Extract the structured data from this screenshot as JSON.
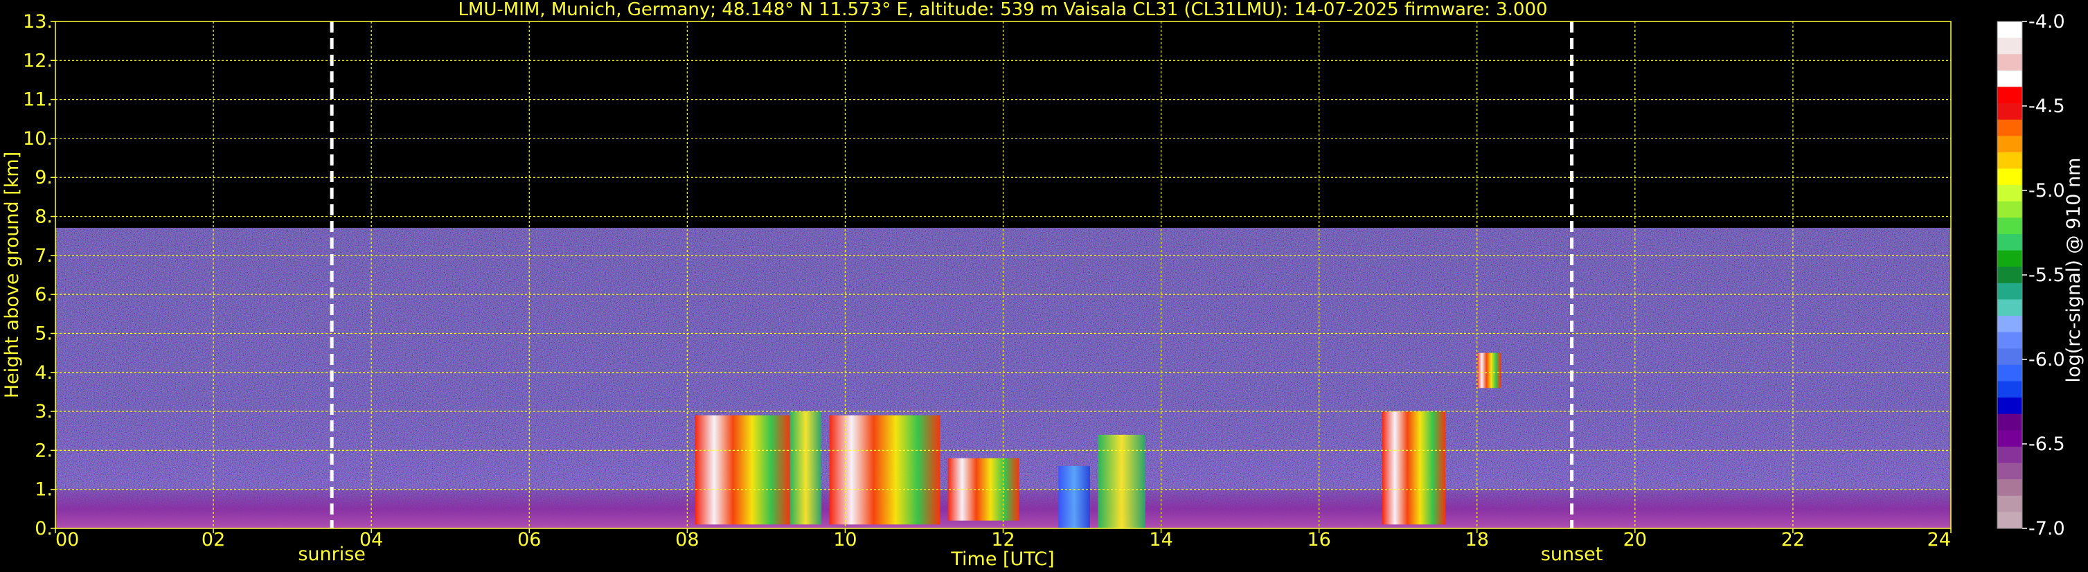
{
  "chart_data": {
    "type": "heatmap",
    "title": "LMU-MIM, Munich, Germany; 48.148° N 11.573° E, altitude: 539 m    Vaisala CL31 (CL31LMU): 14-07-2025    firmware: 3.000",
    "xlabel": "Time [UTC]",
    "ylabel": "Height above ground [km]",
    "xlim": [
      0,
      24
    ],
    "ylim": [
      0,
      13
    ],
    "x_ticks": [
      "00",
      "02",
      "04",
      "06",
      "08",
      "10",
      "12",
      "14",
      "16",
      "18",
      "20",
      "22",
      "24"
    ],
    "x_tick_values": [
      0,
      2,
      4,
      6,
      8,
      10,
      12,
      14,
      16,
      18,
      20,
      22,
      24
    ],
    "y_ticks": [
      "0.",
      "1.",
      "2.",
      "3.",
      "4.",
      "5.",
      "6.",
      "7.",
      "8.",
      "9.",
      "10.",
      "11.",
      "12.",
      "13."
    ],
    "y_tick_values": [
      0,
      1,
      2,
      3,
      4,
      5,
      6,
      7,
      8,
      9,
      10,
      11,
      12,
      13
    ],
    "grid": true,
    "signal_top_km": 7.7,
    "markers": [
      {
        "label": "sunrise",
        "x": 3.5
      },
      {
        "label": "sunset",
        "x": 19.2
      }
    ],
    "cloud_features": [
      {
        "x0": 8.1,
        "x1": 9.3,
        "base": 0.1,
        "top": 2.9,
        "level": "high"
      },
      {
        "x0": 9.3,
        "x1": 9.7,
        "base": 0.1,
        "top": 3.0,
        "level": "mid"
      },
      {
        "x0": 9.8,
        "x1": 11.2,
        "base": 0.1,
        "top": 2.9,
        "level": "high"
      },
      {
        "x0": 11.3,
        "x1": 12.2,
        "base": 0.2,
        "top": 1.8,
        "level": "high"
      },
      {
        "x0": 12.7,
        "x1": 13.1,
        "base": 0.0,
        "top": 1.6,
        "level": "low"
      },
      {
        "x0": 13.2,
        "x1": 13.8,
        "base": 0.0,
        "top": 2.4,
        "level": "mid"
      },
      {
        "x0": 16.8,
        "x1": 17.6,
        "base": 0.1,
        "top": 3.0,
        "level": "high"
      },
      {
        "x0": 18.0,
        "x1": 18.3,
        "base": 3.6,
        "top": 4.5,
        "level": "high"
      }
    ],
    "colorbar": {
      "label": "log(rc-signal) @ 910 nm",
      "min": -7.0,
      "max": -4.0,
      "ticks": [
        "-4.0",
        "-4.5",
        "-5.0",
        "-5.5",
        "-6.0",
        "-6.5",
        "-7.0"
      ],
      "tick_values": [
        -4.0,
        -4.5,
        -5.0,
        -5.5,
        -6.0,
        -6.5,
        -7.0
      ],
      "colors": [
        "#ffffff",
        "#f2e6e6",
        "#f0c0c0",
        "#ffffff",
        "#ff0000",
        "#ee1111",
        "#ff6600",
        "#ff9900",
        "#ffcc00",
        "#ffff00",
        "#ccff33",
        "#99ee33",
        "#55dd44",
        "#33cc66",
        "#11aa11",
        "#118833",
        "#22aa88",
        "#55ccbb",
        "#88aaff",
        "#6688ff",
        "#5577ee",
        "#3366ff",
        "#1144ee",
        "#0000cc",
        "#660088",
        "#770099",
        "#883399",
        "#995599",
        "#aa7799",
        "#bb99aa",
        "#c6aab6"
      ]
    }
  }
}
